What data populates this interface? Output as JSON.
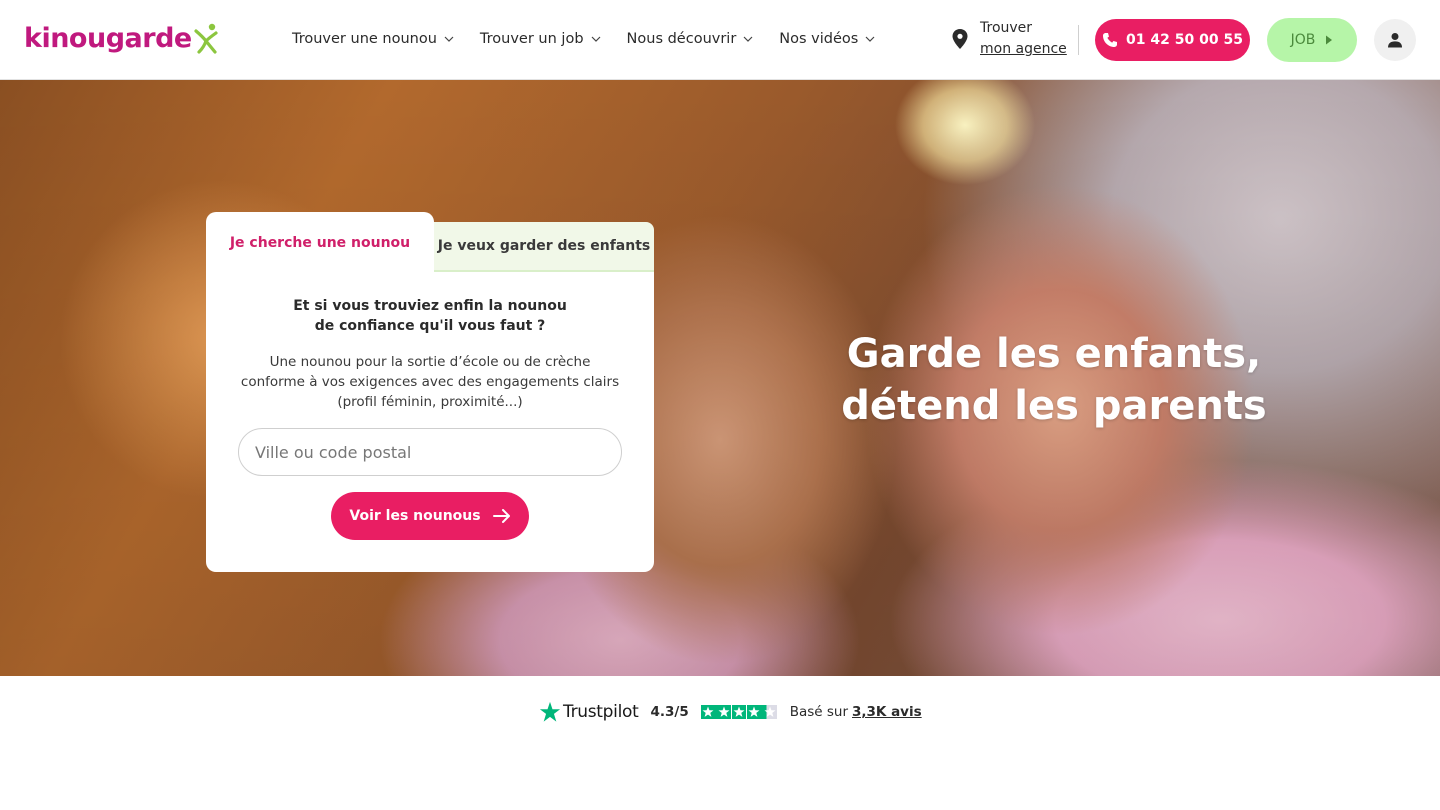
{
  "brand": {
    "name": "kinougarde",
    "accent": "#e91e63",
    "logo_color": "#c0197e",
    "logo_mark_color": "#8cc63f"
  },
  "nav": {
    "items": [
      {
        "label": "Trouver une nounou"
      },
      {
        "label": "Trouver un job"
      },
      {
        "label": "Nous découvrir"
      },
      {
        "label": "Nos vidéos"
      }
    ]
  },
  "agency": {
    "line1": "Trouver",
    "link": "mon agence",
    "icon": "map-pin-icon"
  },
  "phone": {
    "label": "01 42 50 00 55",
    "icon": "phone-icon"
  },
  "job_button": {
    "label": "JOB",
    "color": "#b6f5a8"
  },
  "user_button": {
    "icon": "user-icon"
  },
  "hero": {
    "title_line1": "Garde les enfants,",
    "title_line2": "détend les parents"
  },
  "search_card": {
    "tabs": [
      {
        "label": "Je cherche une nounou",
        "active": true
      },
      {
        "label": "Je veux garder des enfants",
        "active": false
      }
    ],
    "heading_line1": "Et si vous trouviez enfin la nounou",
    "heading_line2": "de confiance qu'il vous faut ?",
    "description": "Une nounou pour la sortie d’école ou de crèche conforme à vos exigences avec des engagements clairs (profil féminin, proximité...)",
    "input": {
      "placeholder": "Ville ou code postal",
      "value": ""
    },
    "cta_label": "Voir les nounous"
  },
  "trustpilot": {
    "brand": "Trustpilot",
    "score": "4.3/5",
    "rating": 4.3,
    "based_on": "Basé sur",
    "count": "3,3K avis",
    "color": "#00b67a"
  }
}
